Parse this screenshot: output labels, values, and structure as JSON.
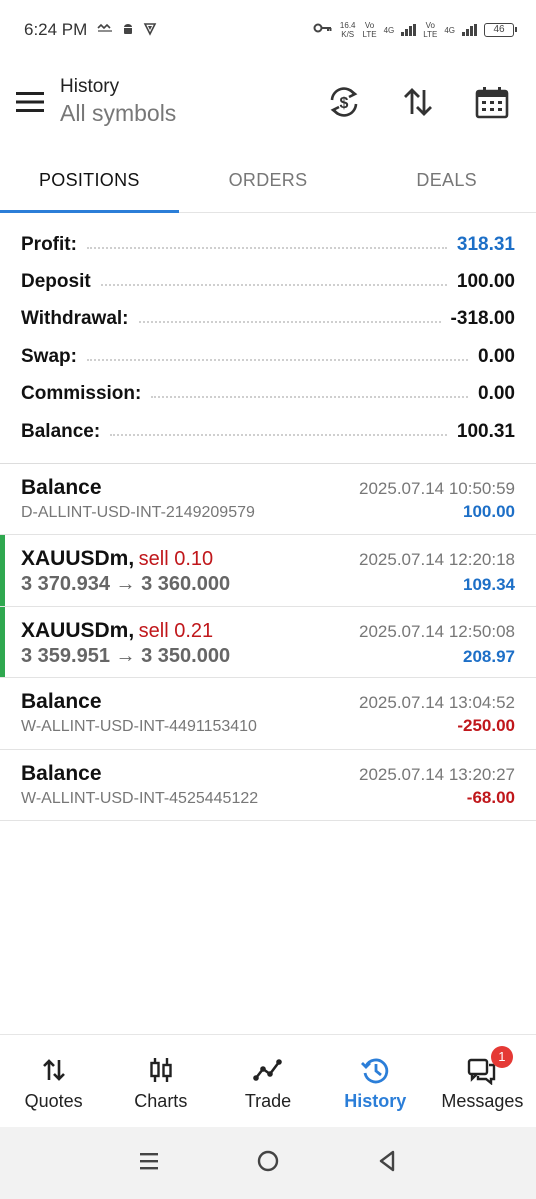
{
  "status_bar": {
    "time": "6:24 PM",
    "speed_value": "16.4",
    "speed_unit": "K/S",
    "volte1": "Vo\nLTE",
    "volte2": "Vo\nLTE",
    "net1": "4G",
    "net2": "4G",
    "battery": "46"
  },
  "header": {
    "title": "History",
    "subtitle": "All symbols"
  },
  "tabs": [
    {
      "label": "POSITIONS",
      "active": true
    },
    {
      "label": "ORDERS",
      "active": false
    },
    {
      "label": "DEALS",
      "active": false
    }
  ],
  "summary": [
    {
      "label": "Profit:",
      "value": "318.31",
      "color": "#1d6fc7"
    },
    {
      "label": "Deposit",
      "value": "100.00"
    },
    {
      "label": "Withdrawal:",
      "value": "-318.00"
    },
    {
      "label": "Swap:",
      "value": "0.00"
    },
    {
      "label": "Commission:",
      "value": "0.00"
    },
    {
      "label": "Balance:",
      "value": "100.31"
    }
  ],
  "entries": [
    {
      "name": "Balance",
      "time": "2025.07.14 10:50:59",
      "sub": "D-ALLINT-USD-INT-2149209579",
      "amount": "100.00",
      "kind": "pos"
    },
    {
      "name": "XAUUSDm,",
      "sell": "sell 0.10",
      "time": "2025.07.14 12:20:18",
      "sub": "3 370.934 → 3 360.000",
      "amount": "109.34",
      "kind": "pos",
      "position": true
    },
    {
      "name": "XAUUSDm,",
      "sell": "sell 0.21",
      "time": "2025.07.14 12:50:08",
      "sub": "3 359.951 → 3 350.000",
      "amount": "208.97",
      "kind": "pos",
      "position": true
    },
    {
      "name": "Balance",
      "time": "2025.07.14 13:04:52",
      "sub": "W-ALLINT-USD-INT-4491153410",
      "amount": "-250.00",
      "kind": "neg"
    },
    {
      "name": "Balance",
      "time": "2025.07.14 13:20:27",
      "sub": "W-ALLINT-USD-INT-4525445122",
      "amount": "-68.00",
      "kind": "neg"
    }
  ],
  "bottom_nav": [
    {
      "label": "Quotes",
      "icon": "quotes-arrows-icon"
    },
    {
      "label": "Charts",
      "icon": "candlestick-icon"
    },
    {
      "label": "Trade",
      "icon": "trade-line-icon"
    },
    {
      "label": "History",
      "icon": "history-clock-icon",
      "active": true
    },
    {
      "label": "Messages",
      "icon": "messages-icon",
      "badge": "1"
    }
  ],
  "colors": {
    "accent": "#2b7ed8",
    "profit_blue": "#1d6fc7",
    "loss_red": "#c0171b",
    "position_green": "#2fa84f"
  }
}
